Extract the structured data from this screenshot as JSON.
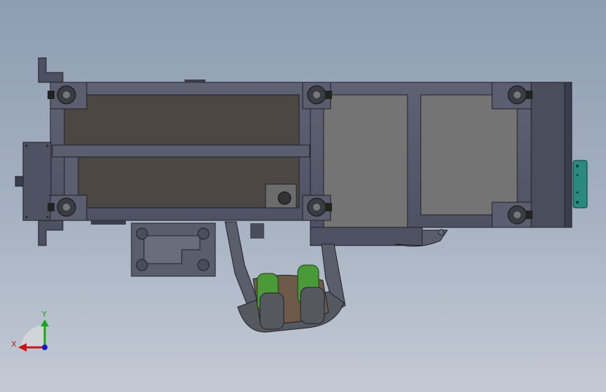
{
  "window": {
    "title": ""
  },
  "colors": {
    "background_top": "#8e9db2",
    "background_bottom": "#c4cad5",
    "frame": "#4a4e5c",
    "frame_face": "#5c6070",
    "dark_panel": "#4c4742",
    "gray_panel": "#737373",
    "green_part": "#4a9a3a",
    "teal_part": "#2a8a80",
    "edge": "#1e2028"
  },
  "triad": {
    "x_label": "X",
    "y_label": "Y",
    "x_color": "#c41818",
    "y_color": "#18a818",
    "z_color": "#1818c8"
  }
}
